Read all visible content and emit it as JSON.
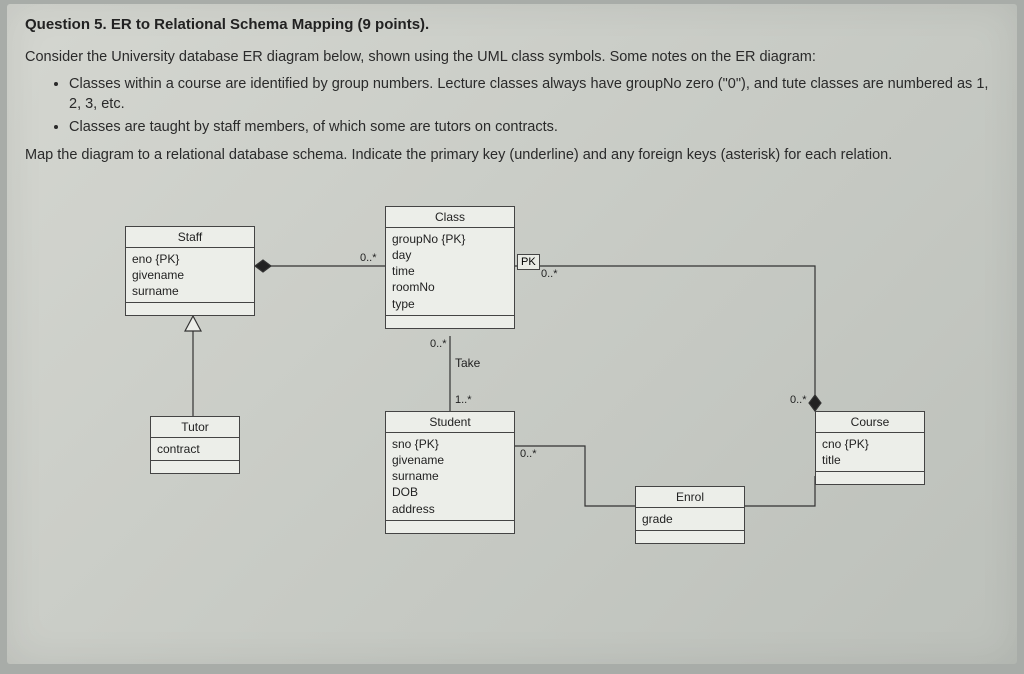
{
  "question": {
    "title": "Question 5. ER to Relational Schema Mapping (9 points).",
    "intro": "Consider the University database ER diagram below, shown using the UML class symbols. Some notes on the ER diagram:",
    "bullet1": "Classes within a course are identified by group numbers. Lecture classes always have groupNo zero (\"0\"), and tute classes are numbered as 1, 2, 3, etc.",
    "bullet2": "Classes are taught by staff members, of which some are tutors on contracts.",
    "task": "Map the diagram to a relational database schema. Indicate the primary key (underline) and any foreign keys (asterisk) for each relation."
  },
  "entities": {
    "staff": {
      "name": "Staff",
      "attrs": [
        "eno {PK}",
        "givename",
        "surname"
      ]
    },
    "tutor": {
      "name": "Tutor",
      "attrs": [
        "contract"
      ]
    },
    "class": {
      "name": "Class",
      "attrs": [
        "groupNo {PK}",
        "day",
        "time",
        "roomNo",
        "type"
      ]
    },
    "student": {
      "name": "Student",
      "attrs": [
        "sno {PK}",
        "givename",
        "surname",
        "DOB",
        "address"
      ]
    },
    "enrol": {
      "name": "Enrol",
      "attrs": [
        "grade"
      ]
    },
    "course": {
      "name": "Course",
      "attrs": [
        "cno {PK}",
        "title"
      ]
    }
  },
  "labels": {
    "pk": "PK",
    "take": "Take",
    "m_staff_class": "0..*",
    "m_class_course": "0..*",
    "m_class_student_top": "0..*",
    "m_class_student_bot": "1..*",
    "m_student_enrol": "0..*",
    "m_course_enrol": "0..*"
  }
}
